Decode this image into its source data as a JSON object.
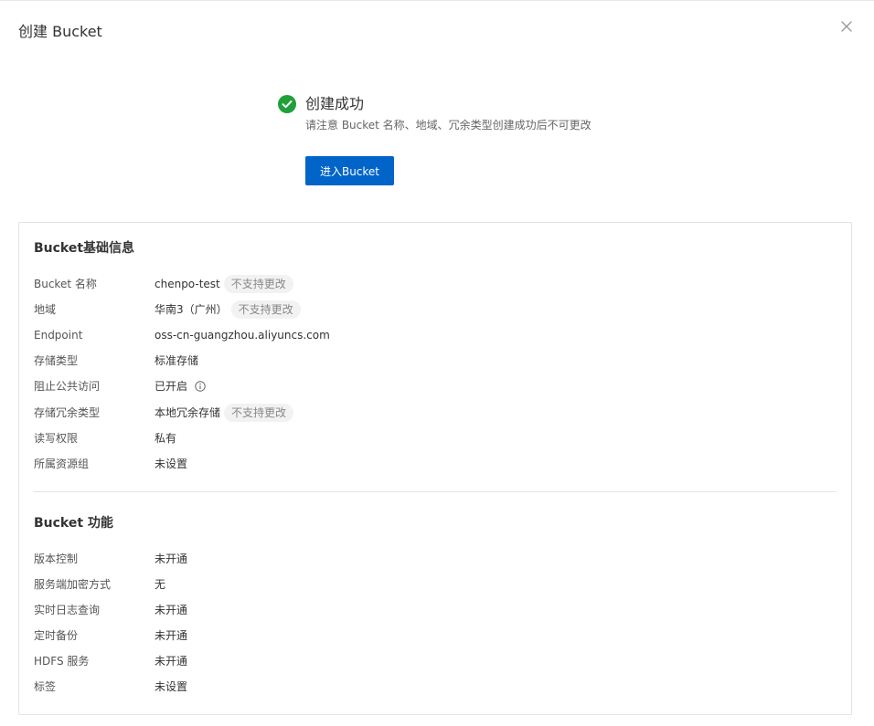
{
  "dialog": {
    "title": "创建 Bucket"
  },
  "success": {
    "title": "创建成功",
    "description": "请注意 Bucket 名称、地域、冗余类型创建成功后不可更改",
    "enter_button": "进入Bucket"
  },
  "basic_info": {
    "title": "Bucket基础信息",
    "rows": [
      {
        "label": "Bucket 名称",
        "value": "chenpo-test",
        "tag": "不支持更改"
      },
      {
        "label": "地域",
        "value": "华南3（广州）",
        "tag": "不支持更改"
      },
      {
        "label": "Endpoint",
        "value": "oss-cn-guangzhou.aliyuncs.com"
      },
      {
        "label": "存储类型",
        "value": "标准存储"
      },
      {
        "label": "阻止公共访问",
        "value": "已开启"
      },
      {
        "label": "存储冗余类型",
        "value": "本地冗余存储",
        "tag": "不支持更改"
      },
      {
        "label": "读写权限",
        "value": "私有"
      },
      {
        "label": "所属资源组",
        "value": "未设置"
      }
    ]
  },
  "features": {
    "title": "Bucket 功能",
    "rows": [
      {
        "label": "版本控制",
        "value": "未开通"
      },
      {
        "label": "服务端加密方式",
        "value": "无"
      },
      {
        "label": "实时日志查询",
        "value": "未开通"
      },
      {
        "label": "定时备份",
        "value": "未开通"
      },
      {
        "label": "HDFS 服务",
        "value": "未开通"
      },
      {
        "label": "标签",
        "value": "未设置"
      }
    ]
  },
  "colors": {
    "primary": "#0064c8",
    "success": "#1ea138"
  },
  "icons": {
    "close": "close-icon",
    "success": "check-circle-icon",
    "info": "info-icon"
  }
}
